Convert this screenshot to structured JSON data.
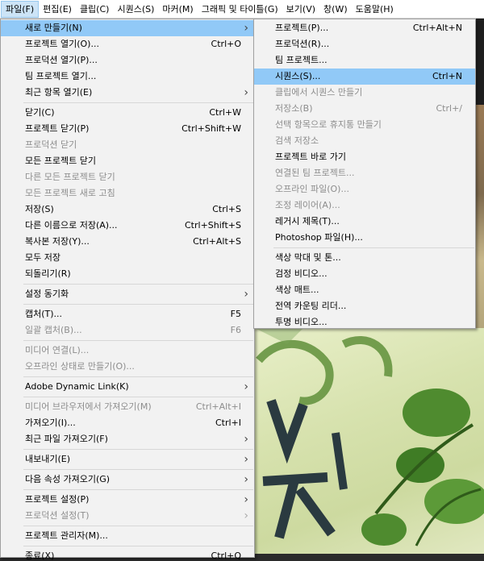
{
  "menubar": [
    {
      "label": "파일(F)",
      "active": true
    },
    {
      "label": "편집(E)"
    },
    {
      "label": "클립(C)"
    },
    {
      "label": "시퀀스(S)"
    },
    {
      "label": "마커(M)"
    },
    {
      "label": "그래픽 및 타이틀(G)"
    },
    {
      "label": "보기(V)"
    },
    {
      "label": "창(W)"
    },
    {
      "label": "도움말(H)"
    }
  ],
  "file_menu": {
    "items": [
      {
        "label": "새로 만들기(N)",
        "submenu": true,
        "highlight": true
      },
      {
        "label": "프로젝트 열기(O)...",
        "shortcut": "Ctrl+O"
      },
      {
        "label": "프로덕션 열기(P)..."
      },
      {
        "label": "팀 프로젝트 열기..."
      },
      {
        "label": "최근 항목 열기(E)",
        "submenu": true
      },
      {
        "sep": true
      },
      {
        "label": "닫기(C)",
        "shortcut": "Ctrl+W"
      },
      {
        "label": "프로젝트 닫기(P)",
        "shortcut": "Ctrl+Shift+W"
      },
      {
        "label": "프로덕션 닫기",
        "disabled": true
      },
      {
        "label": "모든 프로젝트 닫기"
      },
      {
        "label": "다른 모든 프로젝트 닫기",
        "disabled": true
      },
      {
        "label": "모든 프로젝트 새로 고침",
        "disabled": true
      },
      {
        "label": "저장(S)",
        "shortcut": "Ctrl+S"
      },
      {
        "label": "다른 이름으로 저장(A)...",
        "shortcut": "Ctrl+Shift+S"
      },
      {
        "label": "복사본 저장(Y)...",
        "shortcut": "Ctrl+Alt+S"
      },
      {
        "label": "모두 저장"
      },
      {
        "label": "되돌리기(R)"
      },
      {
        "sep": true
      },
      {
        "label": "설정 동기화",
        "submenu": true
      },
      {
        "sep": true
      },
      {
        "label": "캡처(T)...",
        "shortcut": "F5"
      },
      {
        "label": "일괄 캡처(B)...",
        "shortcut": "F6",
        "disabled": true
      },
      {
        "sep": true
      },
      {
        "label": "미디어 연결(L)...",
        "disabled": true
      },
      {
        "label": "오프라인 상태로 만들기(O)...",
        "disabled": true
      },
      {
        "sep": true
      },
      {
        "label": "Adobe Dynamic Link(K)",
        "submenu": true
      },
      {
        "sep": true
      },
      {
        "label": "미디어 브라우저에서 가져오기(M)",
        "shortcut": "Ctrl+Alt+I",
        "disabled": true
      },
      {
        "label": "가져오기(I)...",
        "shortcut": "Ctrl+I"
      },
      {
        "label": "최근 파일 가져오기(F)",
        "submenu": true
      },
      {
        "sep": true
      },
      {
        "label": "내보내기(E)",
        "submenu": true
      },
      {
        "sep": true
      },
      {
        "label": "다음 속성 가져오기(G)",
        "submenu": true
      },
      {
        "sep": true
      },
      {
        "label": "프로젝트 설정(P)",
        "submenu": true
      },
      {
        "label": "프로덕션 설정(T)",
        "submenu": true,
        "disabled": true
      },
      {
        "sep": true
      },
      {
        "label": "프로젝트 관리자(M)..."
      },
      {
        "sep": true
      },
      {
        "label": "종료(X)",
        "shortcut": "Ctrl+Q"
      }
    ]
  },
  "new_menu": {
    "items": [
      {
        "label": "프로젝트(P)...",
        "shortcut": "Ctrl+Alt+N"
      },
      {
        "label": "프로덕션(R)..."
      },
      {
        "label": "팀 프로젝트..."
      },
      {
        "label": "시퀀스(S)...",
        "shortcut": "Ctrl+N",
        "highlight": true
      },
      {
        "label": "클립에서 시퀀스 만들기",
        "disabled": true
      },
      {
        "label": "저장소(B)",
        "shortcut": "Ctrl+/",
        "disabled": true
      },
      {
        "label": "선택 항목으로 휴지통 만들기",
        "disabled": true
      },
      {
        "label": "검색 저장소",
        "disabled": true
      },
      {
        "label": "프로젝트 바로 가기"
      },
      {
        "label": "연결된 팀 프로젝트...",
        "disabled": true
      },
      {
        "label": "오프라인 파일(O)...",
        "disabled": true
      },
      {
        "label": "조정 레이어(A)...",
        "disabled": true
      },
      {
        "label": "레거시 제목(T)..."
      },
      {
        "label": "Photoshop 파일(H)..."
      },
      {
        "sep": true
      },
      {
        "label": "색상 막대 및 톤..."
      },
      {
        "label": "검정 비디오..."
      },
      {
        "label": "색상 매트..."
      },
      {
        "label": "전역 카운팅 리더..."
      },
      {
        "label": "투명 비디오..."
      }
    ]
  },
  "preview": {
    "overlay_text": "ㄹ",
    "overlay_text2": "ㅊ"
  }
}
